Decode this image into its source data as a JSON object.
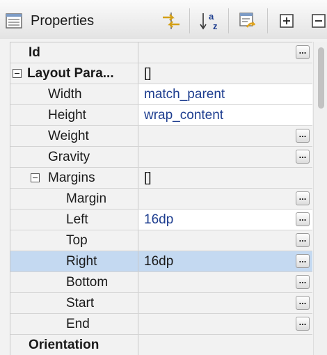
{
  "toolbar": {
    "title": "Properties",
    "title_icon": "properties-panel-icon",
    "buttons": [
      {
        "name": "show-expert-properties-button",
        "icon": "arrows-toggle-icon"
      },
      {
        "name": "sort-alphabetically-button",
        "icon": "sort-az-icon"
      },
      {
        "name": "restore-defaults-button",
        "icon": "restore-defaults-icon"
      },
      {
        "name": "expand-all-button",
        "icon": "expand-all-icon"
      },
      {
        "name": "collapse-all-button",
        "icon": "collapse-all-icon"
      }
    ]
  },
  "properties": [
    {
      "name": "Id",
      "value": "",
      "bold": true,
      "dots": true
    },
    {
      "name": "Layout Para...",
      "value": "[]",
      "bold": true,
      "dots": false,
      "expanded": true
    },
    {
      "name": "Width",
      "value": "match_parent",
      "dots": false
    },
    {
      "name": "Height",
      "value": "wrap_content",
      "dots": false
    },
    {
      "name": "Weight",
      "value": "",
      "dots": true
    },
    {
      "name": "Gravity",
      "value": "",
      "dots": true
    },
    {
      "name": "Margins",
      "value": "[]",
      "dots": false,
      "expanded": true
    },
    {
      "name": "Margin",
      "value": "",
      "dots": true
    },
    {
      "name": "Left",
      "value": "16dp",
      "dots": true
    },
    {
      "name": "Top",
      "value": "",
      "dots": true
    },
    {
      "name": "Right",
      "value": "16dp",
      "dots": true,
      "selected": true
    },
    {
      "name": "Bottom",
      "value": "",
      "dots": true
    },
    {
      "name": "Start",
      "value": "",
      "dots": true
    },
    {
      "name": "End",
      "value": "",
      "dots": true
    },
    {
      "name": "Orientation",
      "value": "",
      "bold": true,
      "dots": false
    }
  ],
  "dots_label": "...",
  "colors": {
    "value_text": "#1d3d8f",
    "selected_row": "#c4d9f1",
    "panel_bg": "#f2f2f2"
  }
}
